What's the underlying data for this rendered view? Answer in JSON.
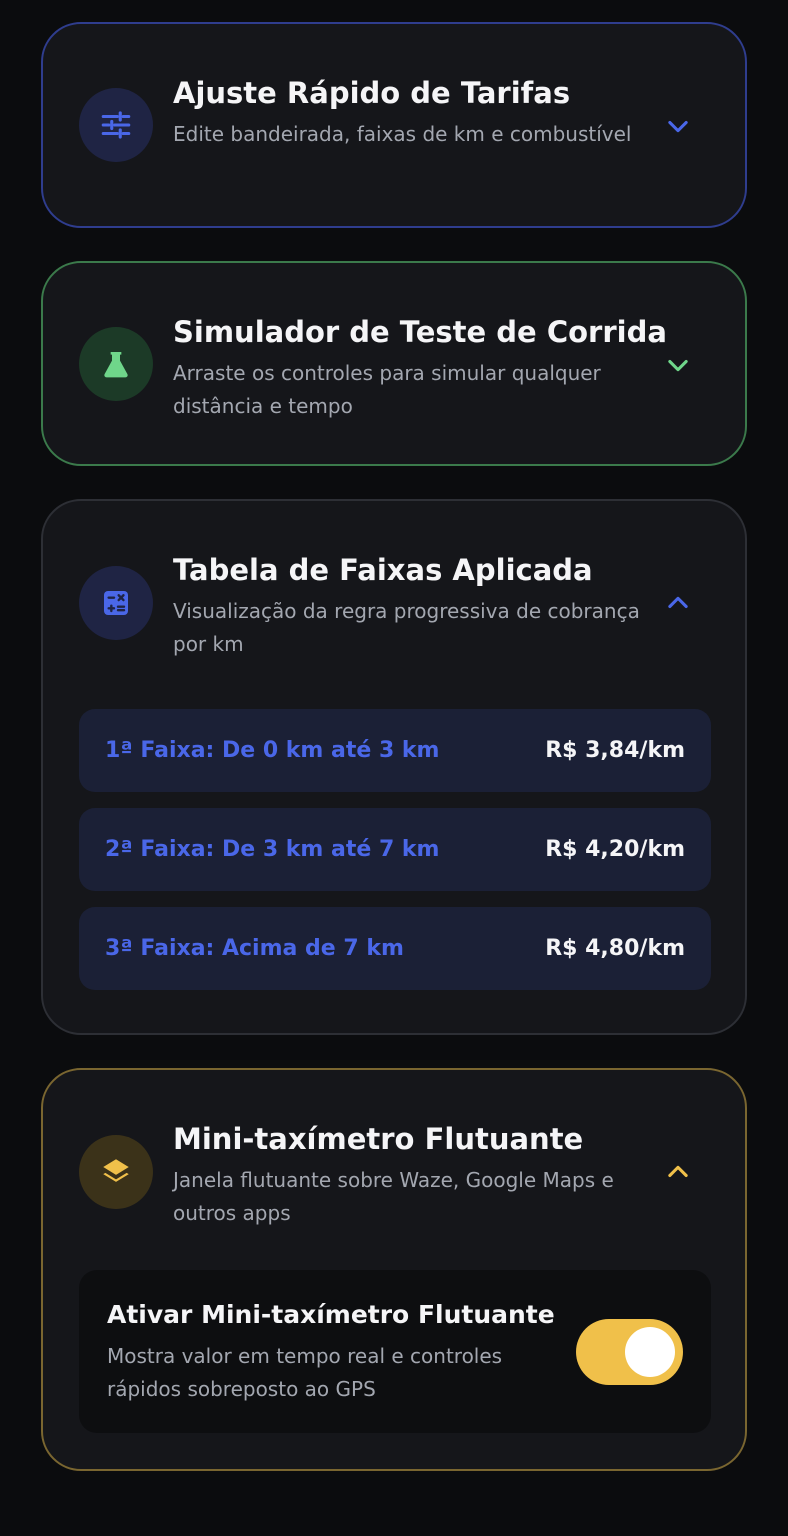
{
  "colors": {
    "background": "#0b0c0e",
    "card": "#15161a",
    "blue_accent": "#4a67e8",
    "green_accent": "#6fd68a",
    "gold_accent": "#f0c04a"
  },
  "cards": {
    "quick_fare": {
      "title": "Ajuste Rápido de Tarifas",
      "subtitle": "Edite bandeirada, faixas de km e combustível",
      "icon": "sliders-icon",
      "expanded": false
    },
    "simulator": {
      "title": "Simulador de Teste de Corrida",
      "subtitle": "Arraste os controles para simular qualquer distância e tempo",
      "icon": "flask-icon",
      "expanded": false
    },
    "tiers": {
      "title": "Tabela de Faixas Aplicada",
      "subtitle": "Visualização da regra progressiva de cobrança por km",
      "icon": "calculator-icon",
      "expanded": true,
      "rows": [
        {
          "label": "1ª Faixa: De 0 km até 3 km",
          "price": "R$ 3,84/km"
        },
        {
          "label": "2ª Faixa: De 3 km até 7 km",
          "price": "R$ 4,20/km"
        },
        {
          "label": "3ª Faixa: Acima de 7 km",
          "price": "R$ 4,80/km"
        }
      ]
    },
    "floating": {
      "title": "Mini-taxímetro Flutuante",
      "subtitle": "Janela flutuante sobre Waze, Google Maps e outros apps",
      "icon": "layers-icon",
      "expanded": true,
      "toggle": {
        "title": "Ativar Mini-taxímetro Flutuante",
        "description": "Mostra valor em tempo real e controles rápidos sobreposto ao GPS",
        "enabled": true
      }
    }
  }
}
